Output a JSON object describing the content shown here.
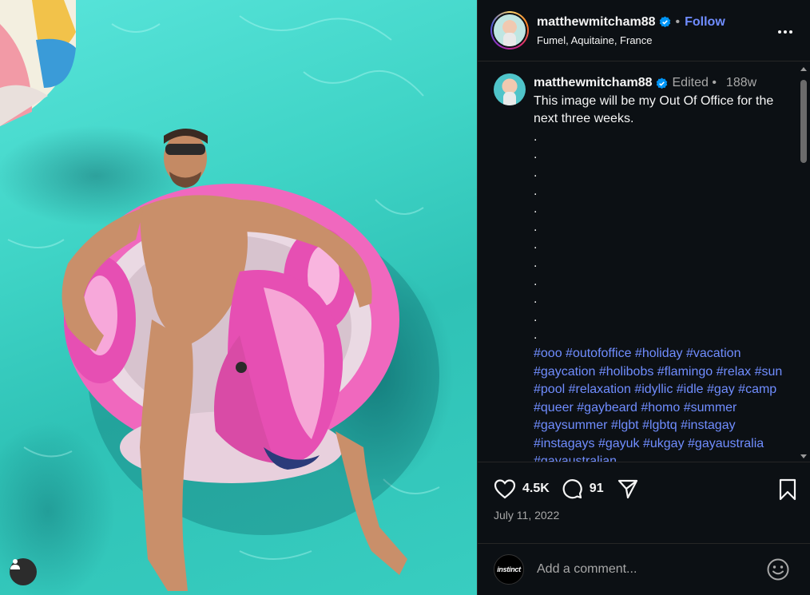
{
  "post": {
    "username": "matthewmitcham88",
    "follow_label": "Follow",
    "dot": "•",
    "location": "Fumel, Aquitaine, France"
  },
  "caption": {
    "username": "matthewmitcham88",
    "edited": "Edited •",
    "age": "188w",
    "text": "This image will be my Out Of Office for the next three weeks.",
    "dots": [
      ".",
      ".",
      ".",
      ".",
      ".",
      ".",
      ".",
      ".",
      ".",
      ".",
      ".",
      "."
    ],
    "hashtags": "#ooo #outofoffice #holiday #vacation #gaycation #holibobs #flamingo #relax #sun #pool #relaxation #idyllic #idle #gay #camp #queer #gaybeard #homo #summer #gaysummer #lgbt #lgbtq #instagay #instagays #gayuk #ukgay #gayaustralia #gayaustralian"
  },
  "actions": {
    "likes": "4.5K",
    "comments": "91"
  },
  "date": "July 11, 2022",
  "comment_box": {
    "commenter_avatar_text": "instinct",
    "placeholder": "Add a comment..."
  },
  "icons": {
    "verified": "verified-badge-icon",
    "more": "more-horizontal-icon",
    "like": "heart-icon",
    "comment": "comment-bubble-icon",
    "share": "paper-plane-icon",
    "save": "bookmark-icon",
    "emoji": "smiley-icon",
    "user_tag": "person-icon"
  },
  "colors": {
    "panel_bg": "#0c1014",
    "link_blue": "#708dff",
    "verified_blue": "#0095f6",
    "muted_text": "#a8a8a8",
    "pool_water": "#3fd4c6",
    "float_pink": "#e64fb3"
  }
}
